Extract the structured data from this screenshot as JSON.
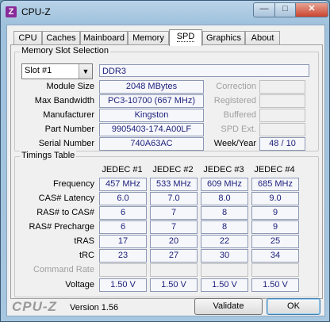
{
  "window": {
    "title": "CPU-Z",
    "icon_letter": "Z",
    "minimize_glyph": "—",
    "maximize_glyph": "□",
    "close_glyph": "✕"
  },
  "tabs": [
    {
      "label": "CPU"
    },
    {
      "label": "Caches"
    },
    {
      "label": "Mainboard"
    },
    {
      "label": "Memory"
    },
    {
      "label": "SPD"
    },
    {
      "label": "Graphics"
    },
    {
      "label": "About"
    }
  ],
  "active_tab": "SPD",
  "slot_section": {
    "title": "Memory Slot Selection",
    "slot_selected": "Slot #1",
    "memory_type": "DDR3",
    "rows": [
      {
        "label": "Module Size",
        "value": "2048 MBytes",
        "side_label": "Correction",
        "side_value": ""
      },
      {
        "label": "Max Bandwidth",
        "value": "PC3-10700 (667 MHz)",
        "side_label": "Registered",
        "side_value": ""
      },
      {
        "label": "Manufacturer",
        "value": "Kingston",
        "side_label": "Buffered",
        "side_value": ""
      },
      {
        "label": "Part Number",
        "value": "9905403-174.A00LF",
        "side_label": "SPD Ext.",
        "side_value": ""
      },
      {
        "label": "Serial Number",
        "value": "740A63AC",
        "side_label": "Week/Year",
        "side_value": "48 / 10"
      }
    ]
  },
  "timings": {
    "title": "Timings Table",
    "columns": [
      "JEDEC #1",
      "JEDEC #2",
      "JEDEC #3",
      "JEDEC #4"
    ],
    "rows": [
      {
        "label": "Frequency",
        "values": [
          "457 MHz",
          "533 MHz",
          "609 MHz",
          "685 MHz"
        ]
      },
      {
        "label": "CAS# Latency",
        "values": [
          "6.0",
          "7.0",
          "8.0",
          "9.0"
        ]
      },
      {
        "label": "RAS# to CAS#",
        "values": [
          "6",
          "7",
          "8",
          "9"
        ]
      },
      {
        "label": "RAS# Precharge",
        "values": [
          "6",
          "7",
          "8",
          "9"
        ]
      },
      {
        "label": "tRAS",
        "values": [
          "17",
          "20",
          "22",
          "25"
        ]
      },
      {
        "label": "tRC",
        "values": [
          "23",
          "27",
          "30",
          "34"
        ]
      },
      {
        "label": "Command Rate",
        "values": [
          "",
          "",
          "",
          ""
        ]
      },
      {
        "label": "Voltage",
        "values": [
          "1.50 V",
          "1.50 V",
          "1.50 V",
          "1.50 V"
        ]
      }
    ]
  },
  "footer": {
    "brand": "CPU-Z",
    "version": "Version 1.56",
    "validate_label": "Validate",
    "ok_label": "OK"
  }
}
